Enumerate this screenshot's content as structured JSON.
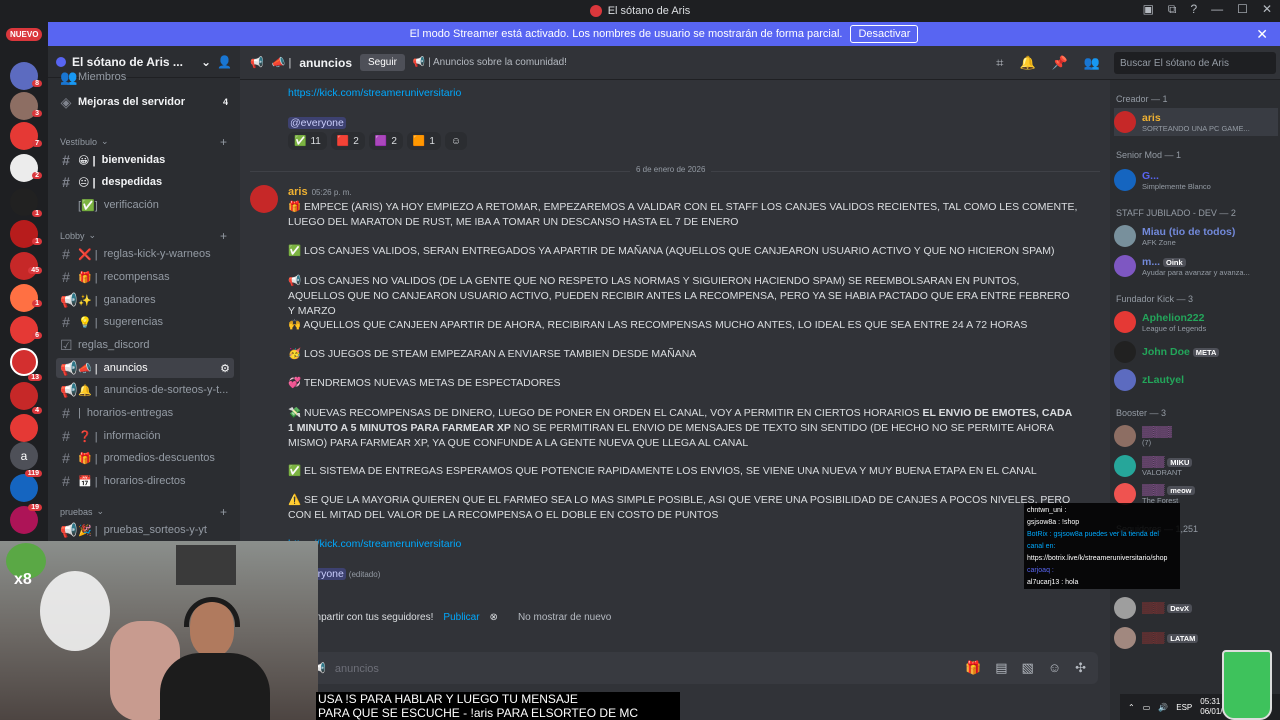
{
  "titlebar": {
    "title": "El sótano de Aris"
  },
  "banner": {
    "text": "El modo Streamer está activado. Los nombres de usuario se mostrarán de forma parcial.",
    "button": "Desactivar"
  },
  "rail": {
    "nuevo": "NUEVO",
    "badges": [
      "8",
      "3",
      "7",
      "2",
      "1",
      "1",
      "45",
      "1",
      "6",
      "1",
      "13",
      "4",
      "119",
      "19"
    ],
    "letter": "a"
  },
  "sidebar": {
    "server_name": "El sótano de Aris ...",
    "items": [
      {
        "label": "Miembros"
      },
      {
        "label": "Mejoras del servidor",
        "count": "4"
      }
    ],
    "categories": {
      "vestibulo": "Vestíbulo",
      "lobby": "Lobby",
      "pruebas": "pruebas"
    },
    "channels": {
      "bienvenidas": "bienvenidas",
      "despedidas": "despedidas",
      "verificacion": "verificación",
      "reglas": "reglas-kick-y-warneos",
      "recompensas": "recompensas",
      "ganadores": "ganadores",
      "sugerencias": "sugerencias",
      "reglas_discord": "reglas_discord",
      "anuncios": "anuncios",
      "anuncios_sorteos": "anuncios-de-sorteos-y-t...",
      "horarios_entregas": "horarios-entregas",
      "informacion": "información",
      "promedios": "promedios-descuentos",
      "horarios_directos": "horarios-directos",
      "pruebas_sorteos": "pruebas_sorteos-y-yt"
    }
  },
  "header": {
    "channel": "anuncios",
    "follow": "Seguir",
    "topic": "Anuncios sobre la comunidad!",
    "search_placeholder": "Buscar El sótano de Aris"
  },
  "messages": {
    "prev_link": "https://kick.com/streameruniversitario",
    "everyone": "@everyone",
    "reactions": [
      "11",
      "2",
      "2",
      "1"
    ],
    "date_divider": "6 de enero de 2026",
    "author": "aris",
    "time": "05:26 p. m.",
    "paragraphs": {
      "p1": "EMPECE (ARIS) YA HOY EMPIEZO A RETOMAR, EMPEZAREMOS A VALIDAR CON EL STAFF LOS CANJES VALIDOS RECIENTES, TAL COMO LES COMENTE, LUEGO DEL MARATON DE RUST, ME IBA A TOMAR UN DESCANSO HASTA EL 7 DE ENERO",
      "p2": "LOS CANJES VALIDOS, SERAN ENTREGADOS YA APARTIR DE MAÑANA (AQUELLOS QUE CANJEARON USUARIO ACTIVO Y QUE NO HICIERON SPAM)",
      "p3": "LOS CANJES NO VALIDOS (DE LA GENTE QUE NO RESPETO LAS NORMAS Y SIGUIERON HACIENDO SPAM) SE REEMBOLSARAN EN PUNTOS, AQUELLOS QUE NO CANJEARON USUARIO ACTIVO, PUEDEN RECIBIR ANTES LA RECOMPENSA, PERO YA SE HABIA PACTADO QUE ERA ENTRE FEBRERO Y MARZO",
      "p4": "AQUELLOS QUE CANJEEN APARTIR DE AHORA, RECIBIRAN LAS RECOMPENSAS MUCHO ANTES, LO IDEAL ES QUE SEA ENTRE 24 A 72 HORAS",
      "p5": "LOS JUEGOS DE STEAM EMPEZARAN A ENVIARSE TAMBIEN DESDE MAÑANA",
      "p6": "TENDREMOS NUEVAS METAS DE ESPECTADORES",
      "p7a": "NUEVAS RECOMPENSAS DE DINERO, LUEGO DE PONER EN ORDEN EL CANAL, VOY A PERMITIR EN CIERTOS HORARIOS",
      "p7b": "EL ENVIO DE EMOTES, CADA 1 MINUTO A 5 MINUTOS PARA FARMEAR XP",
      "p7c": "NO SE PERMITIRAN EL ENVIO DE MENSAJES DE TEXTO SIN SENTIDO (DE HECHO NO SE PERMITE AHORA MISMO) PARA FARMEAR XP, YA QUE CONFUNDE A LA GENTE NUEVA QUE LLEGA AL CANAL",
      "p8": "EL SISTEMA DE ENTREGAS ESPERAMOS QUE POTENCIE RAPIDAMENTE LOS ENVIOS, SE VIENE UNA NUEVA Y MUY BUENA ETAPA EN EL CANAL",
      "p9": "SE QUE LA MAYORIA QUIEREN QUE EL FARMEO SEA LO MAS SIMPLE POSIBLE, ASI QUE VERE UNA POSIBILIDAD DE CANJES A POCOS NIVELES, PERO CON EL MITAD DEL VALOR DE LA RECOMPENSA O EL DOBLE EN COSTO DE PUNTOS"
    },
    "link2": "https://kick.com/streameruniversitario",
    "everyone2": "@everyone",
    "edited": "(editado)"
  },
  "promo": {
    "text": "Compartir con tus seguidores!",
    "publish": "Publicar",
    "dismiss": "No mostrar de nuevo"
  },
  "composer": {
    "placeholder": "anuncios"
  },
  "members": {
    "groups": {
      "creador": "Creador — 1",
      "senior": "Senior Mod — 1",
      "staff": "STAFF JUBILADO - DEV — 2",
      "fundador": "Fundador Kick — 3",
      "booster": "Booster — 3",
      "seguidores": "Seguidores — 1,251"
    },
    "list": {
      "aris": {
        "name": "aris",
        "status": "SORTEANDO UNA PC GAME..."
      },
      "g": {
        "name": "G...",
        "status": "Simplemente Blanco"
      },
      "miau": {
        "name": "Miau (tio de todos)",
        "status": "AFK Zone"
      },
      "m": {
        "name": "m...",
        "status": "Ayudar para avanzar y avanza...",
        "tag": "Oink"
      },
      "aphelion": {
        "name": "Aphelion222",
        "status": "League of Legends"
      },
      "john": {
        "name": "John Doe",
        "tag": "META"
      },
      "zlautyel": {
        "name": "zLautyel"
      },
      "b1": {
        "status": "(7)"
      },
      "b2": {
        "status": "VALORANT",
        "tag": "MIKU"
      },
      "b3": {
        "status": "The Forest",
        "tag": "meow"
      },
      "s1": {
        "tag": "DevX"
      },
      "s2": {
        "tag": "LATAM"
      }
    }
  },
  "chat_overlay": {
    "lines": [
      "chntwn_uni :",
      "gsjsow8a : !shop",
      "BotRix : gsjsow8a puedes ver la tienda del canal en:",
      "https://botrix.live/k/streameruniversitario/shop",
      "carjoaq :",
      "al7ucarj13 : hola"
    ],
    "tick": "TICK"
  },
  "caption": {
    "line1": "USA !S PARA HABLAR Y LUEGO TU MENSAJE",
    "line2": "PARA QUE SE ESCUCHE - !aris PARA ELSORTEO DE MC PERMA"
  },
  "taskbar": {
    "lang": "ESP",
    "time": "05:31",
    "date": "06/01/"
  },
  "webcam": {
    "badge": "x8"
  }
}
